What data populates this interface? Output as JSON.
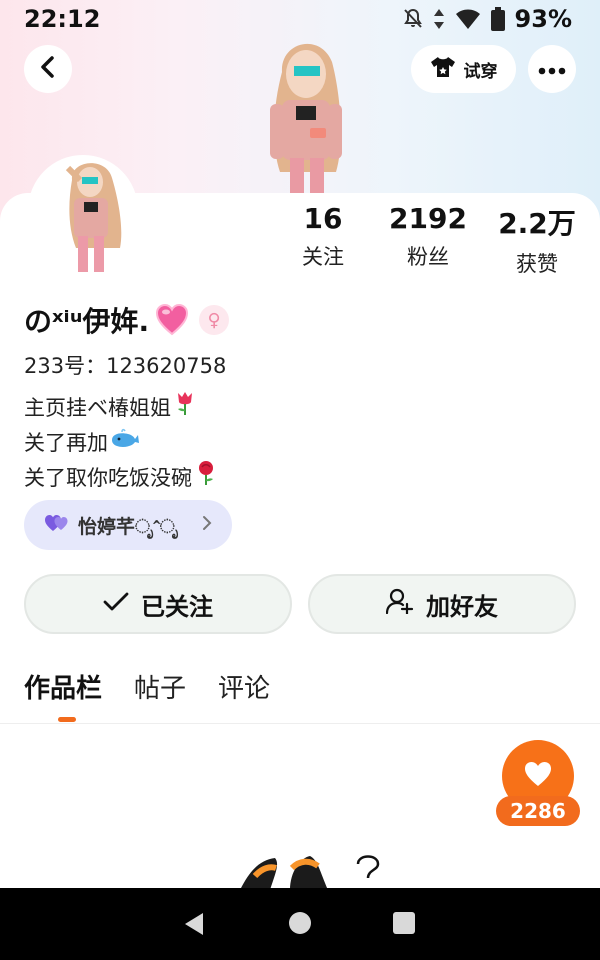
{
  "status_bar": {
    "time": "22:12",
    "battery": "93%",
    "icons": [
      "notifications-off-icon",
      "data-arrows-icon",
      "wifi-icon",
      "battery-icon"
    ]
  },
  "header": {
    "back_icon": "chevron-left-icon",
    "tryon_label": "试穿",
    "tryon_icon": "tshirt-icon",
    "more_icon": "more-dots-icon"
  },
  "profile": {
    "nickname": "のˣⁱᵘ伊姩.",
    "uid": "233号：123620758",
    "bio": [
      "主页挂ベ椿姐姐",
      "关了再加",
      "关了取你吃饭没碗"
    ],
    "fan_tag": "怡婷芊ೃˆೃ",
    "stats": [
      {
        "value": "16",
        "label": "关注"
      },
      {
        "value": "2192",
        "label": "粉丝"
      },
      {
        "value": "2.2万",
        "label": "获赞"
      }
    ]
  },
  "actions": {
    "followed_label": "已关注",
    "add_friend_label": "加好友"
  },
  "tabs": [
    "作品栏",
    "帖子",
    "评论"
  ],
  "like_fab": {
    "count": "2286"
  },
  "colors": {
    "accent": "#f26b1d",
    "tag_bg": "#e6e8fb",
    "button_bg": "#f1f5f2"
  }
}
